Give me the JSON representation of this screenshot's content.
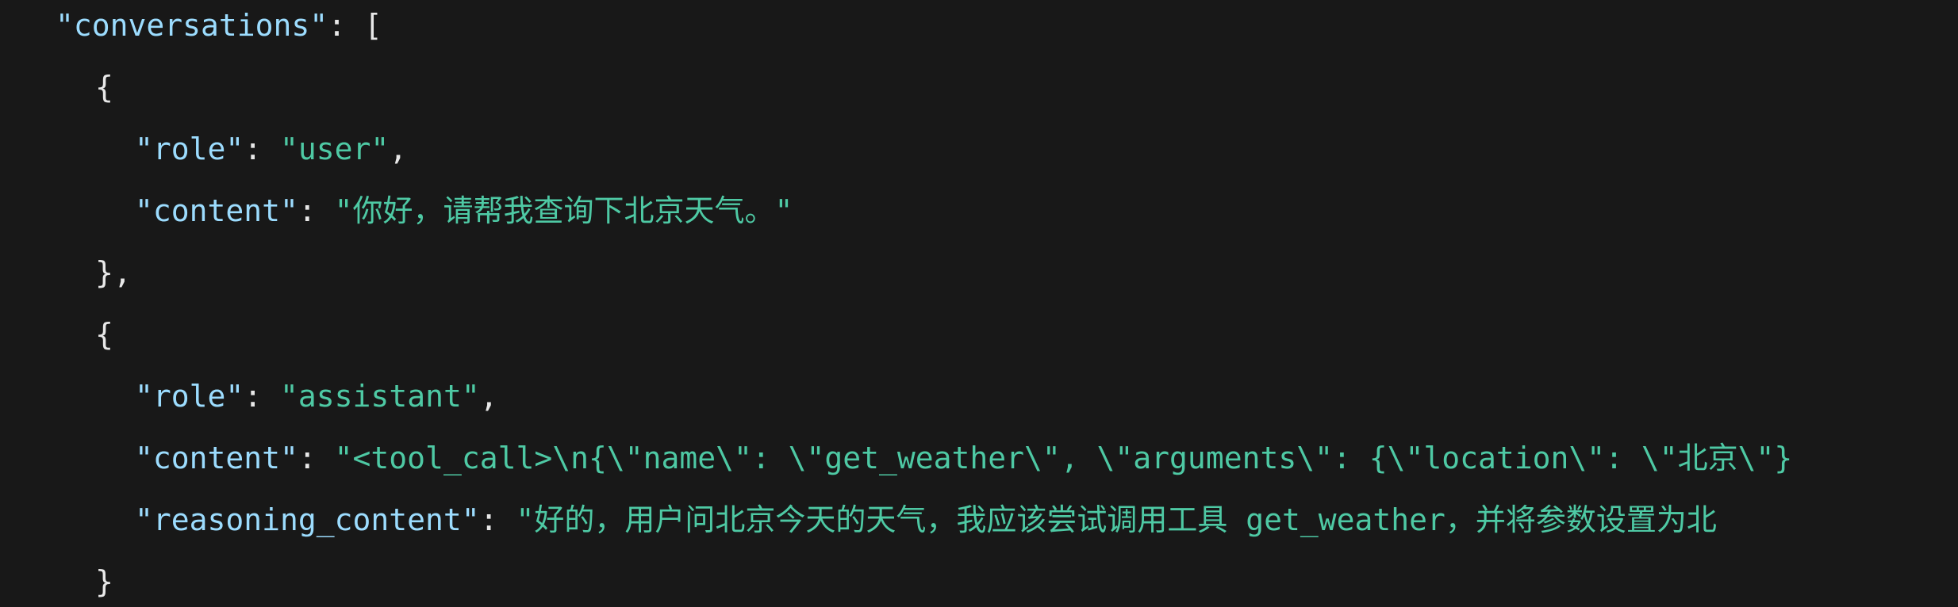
{
  "colors": {
    "background": "#181818",
    "key": "#9cdcfe",
    "string": "#4ec9a4",
    "punctuation": "#e8e8e8"
  },
  "code": {
    "line0": {
      "key": "\"conversations\"",
      "sep": ": ",
      "open": "["
    },
    "line1": {
      "brace": "{"
    },
    "line2": {
      "key": "\"role\"",
      "sep": ": ",
      "value": "\"user\"",
      "trail": ","
    },
    "line3": {
      "key": "\"content\"",
      "sep": ": ",
      "value": "\"你好，请帮我查询下北京天气。\""
    },
    "line4": {
      "brace": "},"
    },
    "line5": {
      "brace": "{"
    },
    "line6": {
      "key": "\"role\"",
      "sep": ": ",
      "value": "\"assistant\"",
      "trail": ","
    },
    "line7": {
      "key": "\"content\"",
      "sep": ": ",
      "value": "\"<tool_call>\\n{\\\"name\\\": \\\"get_weather\\\", \\\"arguments\\\": {\\\"location\\\": \\\"北京\\\"}"
    },
    "line8": {
      "key": "\"reasoning_content\"",
      "sep": ": ",
      "value": "\"好的，用户问北京今天的天气，我应该尝试调用工具 get_weather，并将参数设置为北"
    },
    "line9": {
      "brace": "}"
    }
  }
}
